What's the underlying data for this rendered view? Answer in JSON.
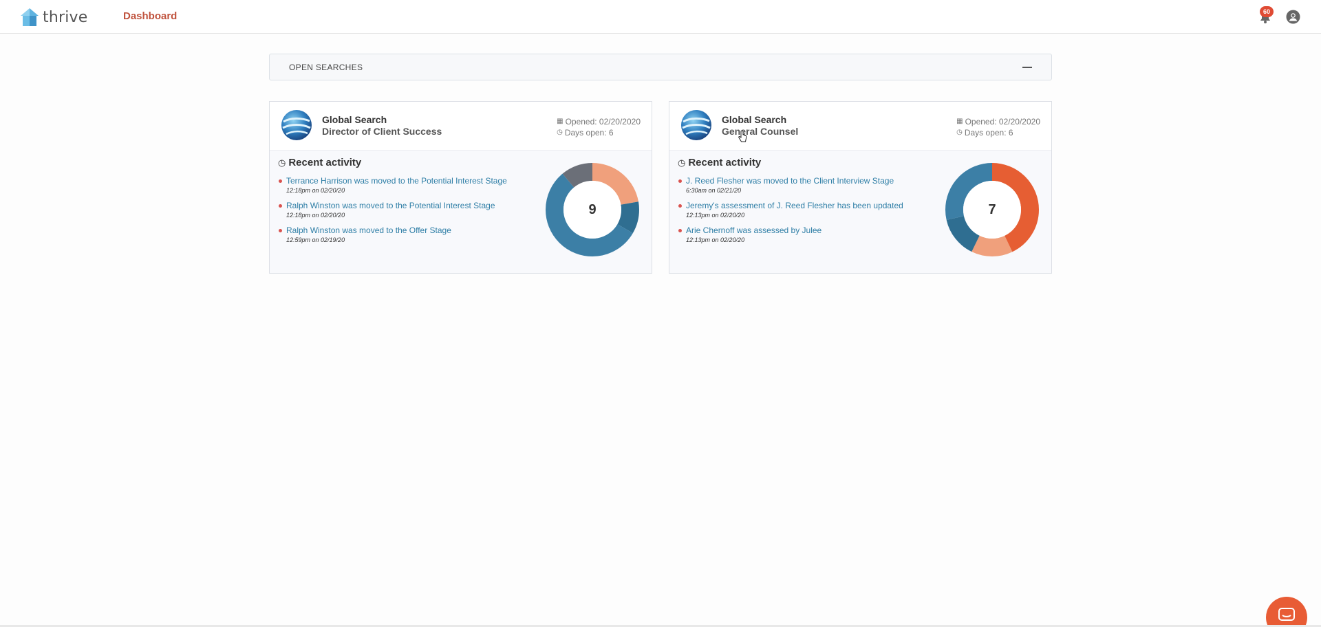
{
  "app": {
    "brand": "thrive",
    "nav_dashboard": "Dashboard",
    "notification_count": "60"
  },
  "open_searches": {
    "title": "OPEN SEARCHES"
  },
  "cards": [
    {
      "company": "Global Search",
      "role": "Director of Client Success",
      "opened": "Opened: 02/20/2020",
      "days_open": "Days open: 6",
      "activity_title": "Recent activity",
      "activities": [
        {
          "text": "Terrance Harrison was moved to the Potential Interest Stage",
          "time": "12:18pm on 02/20/20"
        },
        {
          "text": "Ralph Winston was moved to the Potential Interest Stage",
          "time": "12:18pm on 02/20/20"
        },
        {
          "text": "Ralph Winston was moved to the Offer Stage",
          "time": "12:59pm on 02/19/20"
        }
      ],
      "donut_total": "9",
      "donut_segments": [
        {
          "value": 2,
          "color": "#f0a07c"
        },
        {
          "value": 1,
          "color": "#2f6e91"
        },
        {
          "value": 5,
          "color": "#3c7fa6"
        },
        {
          "value": 1,
          "color": "#6b6f78"
        }
      ]
    },
    {
      "company": "Global Search",
      "role": "General Counsel",
      "opened": "Opened: 02/20/2020",
      "days_open": "Days open: 6",
      "activity_title": "Recent activity",
      "activities": [
        {
          "text": "J. Reed Flesher was moved to the Client Interview Stage",
          "time": "6:30am on 02/21/20"
        },
        {
          "text": "Jeremy's assessment of J. Reed Flesher has been updated",
          "time": "12:13pm on 02/20/20"
        },
        {
          "text": "Arie Chernoff was assessed by Julee",
          "time": "12:13pm on 02/20/20"
        }
      ],
      "donut_total": "7",
      "donut_segments": [
        {
          "value": 3,
          "color": "#e65e33"
        },
        {
          "value": 1,
          "color": "#f0a07c"
        },
        {
          "value": 1,
          "color": "#2f6e91"
        },
        {
          "value": 2,
          "color": "#3c7fa6"
        }
      ]
    }
  ],
  "colors": {
    "accent": "#c0533e",
    "link": "#2e7ea6",
    "badge": "#e04b34",
    "chat": "#e85c35"
  },
  "icons": [
    "logo-icon",
    "bell-icon",
    "user-icon",
    "collapse-icon",
    "globe-icon",
    "calendar-icon",
    "clock-icon",
    "chat-icon",
    "cursor-icon"
  ]
}
